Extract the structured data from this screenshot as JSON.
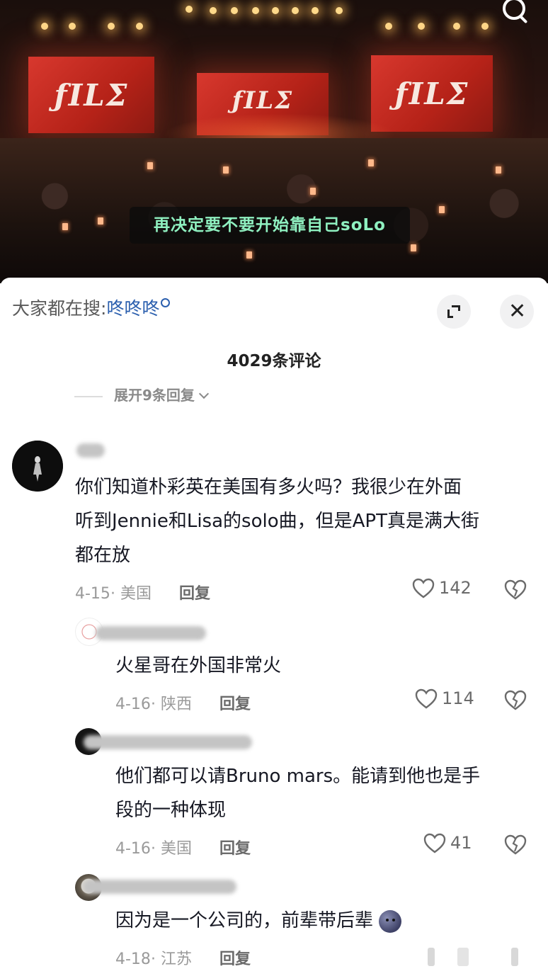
{
  "video": {
    "screen_logo": "ƒILΣ",
    "subtitle": "再决定要不要开始靠自己soLo",
    "search_icon": "search-icon"
  },
  "panel": {
    "search_prefix": "大家都在搜:",
    "search_keyword": "咚咚咚",
    "comment_count": "4029条评论",
    "expand_replies": "展开9条回复"
  },
  "comments": [
    {
      "text_line1": "你们知道朴彩英在美国有多火吗？我很少在外面",
      "text_line2": "听到Jennie和Lisa的solo曲，但是APT真是满大街",
      "text_line3": "都在放",
      "date": "4-15",
      "location": "美国",
      "reply_label": "回复",
      "likes": "142"
    }
  ],
  "replies": [
    {
      "text": "火星哥在外国非常火",
      "date": "4-16",
      "location": "陕西",
      "reply_label": "回复",
      "likes": "114"
    },
    {
      "text_line1": "他们都可以请Bruno mars。能请到他也是手",
      "text_line2": "段的一种体现",
      "date": "4-16",
      "location": "美国",
      "reply_label": "回复",
      "likes": "41"
    },
    {
      "text": "因为是一个公司的，前辈带后辈",
      "date": "4-18",
      "location": "江苏",
      "reply_label": "回复",
      "emoji": "moon-face-emoji"
    }
  ],
  "colors": {
    "subtitle_text": "#8ff0c0",
    "keyword": "#2b5fae",
    "screen_red": "#d8382e"
  }
}
